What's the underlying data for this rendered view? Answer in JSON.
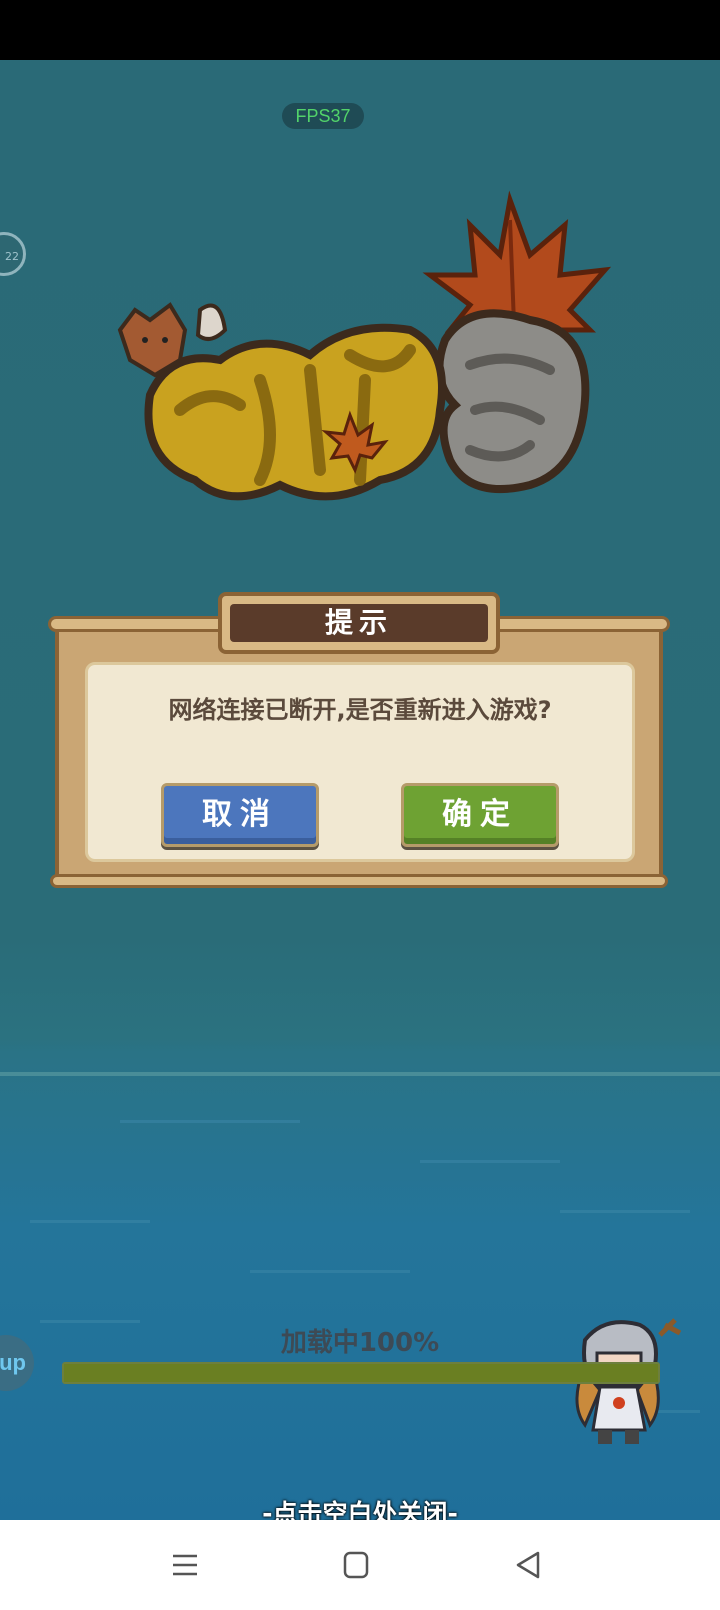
{
  "hud": {
    "fps_label": "FPS37",
    "float_circle_label": "22",
    "float_app_label": "up"
  },
  "logo": {
    "name": "logo-title-artwork"
  },
  "dialog": {
    "title": "提示",
    "message": "网络连接已断开,是否重新进入游戏?",
    "cancel_label": "取消",
    "confirm_label": "确定"
  },
  "loading": {
    "label": "加载中100%",
    "progress": 1.0
  },
  "close_hint": "-点击空白处关闭-",
  "navbar": {
    "icons": [
      "menu-icon",
      "home-square-icon",
      "back-triangle-icon"
    ]
  },
  "colors": {
    "cancel_button": "#4c76bd",
    "confirm_button": "#6ea233",
    "fps_text": "#52d36a",
    "background": "#2a6a77"
  }
}
